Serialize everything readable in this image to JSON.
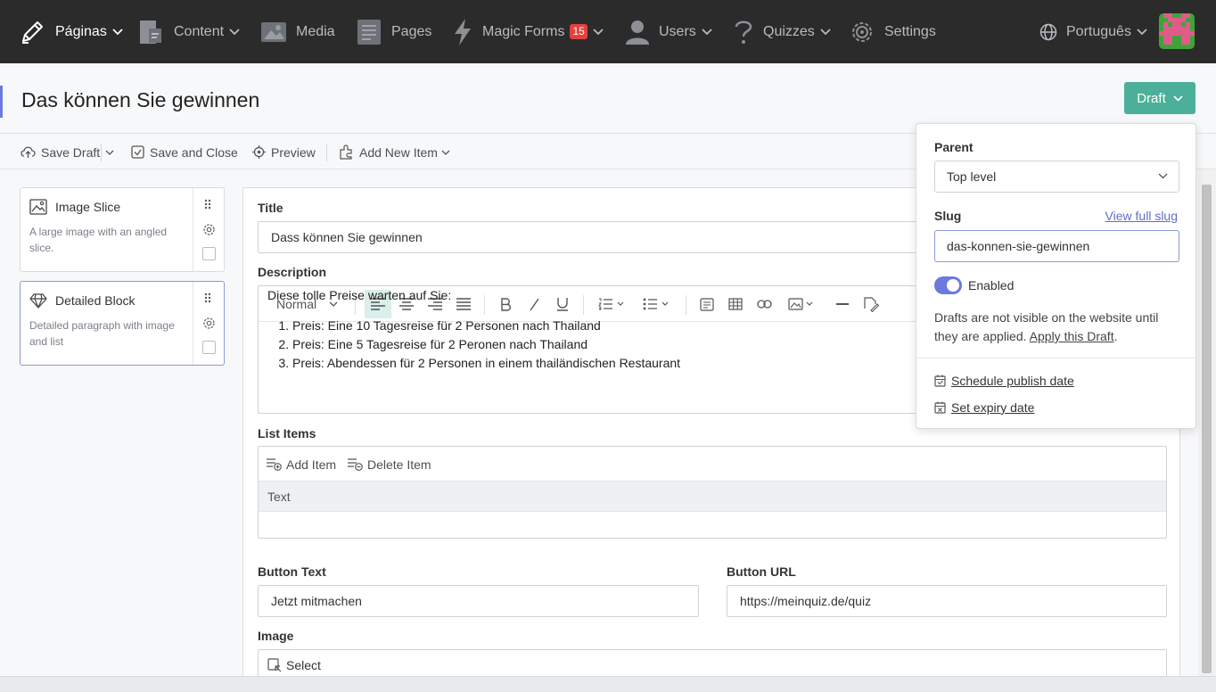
{
  "nav": {
    "brand": "Páginas",
    "items": [
      {
        "label": "Content"
      },
      {
        "label": "Media"
      },
      {
        "label": "Pages"
      },
      {
        "label": "Magic Forms",
        "badge": "15"
      },
      {
        "label": "Users"
      },
      {
        "label": "Quizzes"
      },
      {
        "label": "Settings"
      }
    ],
    "language": "Português"
  },
  "header": {
    "title": "Das können Sie gewinnen",
    "status_button": "Draft"
  },
  "toolbar": {
    "save_draft": "Save Draft",
    "save_close": "Save and Close",
    "preview": "Preview",
    "add_new_item": "Add New Item"
  },
  "blocks": [
    {
      "title": "Image Slice",
      "description": "A large image with an angled slice."
    },
    {
      "title": "Detailed Block",
      "description": "Detailed paragraph with image and list"
    }
  ],
  "editor": {
    "title_label": "Title",
    "title_value": "Dass können Sie gewinnen",
    "description_label": "Description",
    "format_select": "Normal",
    "content_intro": "Diese tolle Preise warten auf Sie:",
    "content_list": [
      "Preis: Eine 10 Tagesreise für 2 Personen nach Thailand",
      "Preis: Eine 5 Tagesreise für 2 Peronen nach Thailand",
      "Preis: Abendessen für 2 Personen in einem thailändischen Restaurant"
    ],
    "list_items_label": "List Items",
    "add_item": "Add Item",
    "delete_item": "Delete Item",
    "list_column": "Text",
    "button_text_label": "Button Text",
    "button_text_value": "Jetzt mitmachen",
    "button_url_label": "Button URL",
    "button_url_value": "https://meinquiz.de/quiz",
    "image_label": "Image",
    "image_select": "Select"
  },
  "popover": {
    "parent_label": "Parent",
    "parent_value": "Top level",
    "slug_label": "Slug",
    "view_full_slug": "View full slug",
    "slug_value": "das-konnen-sie-gewinnen",
    "enabled_label": "Enabled",
    "enabled": true,
    "note_text": "Drafts are not visible on the website until they are applied.",
    "apply_link": "Apply this Draft",
    "schedule_link": "Schedule publish date",
    "expiry_link": "Set expiry date"
  },
  "colors": {
    "topbar": "#2b2b2b",
    "accent_green": "#4caf9a",
    "accent_blue": "#6c7ae0",
    "badge_red": "#e5413c"
  }
}
